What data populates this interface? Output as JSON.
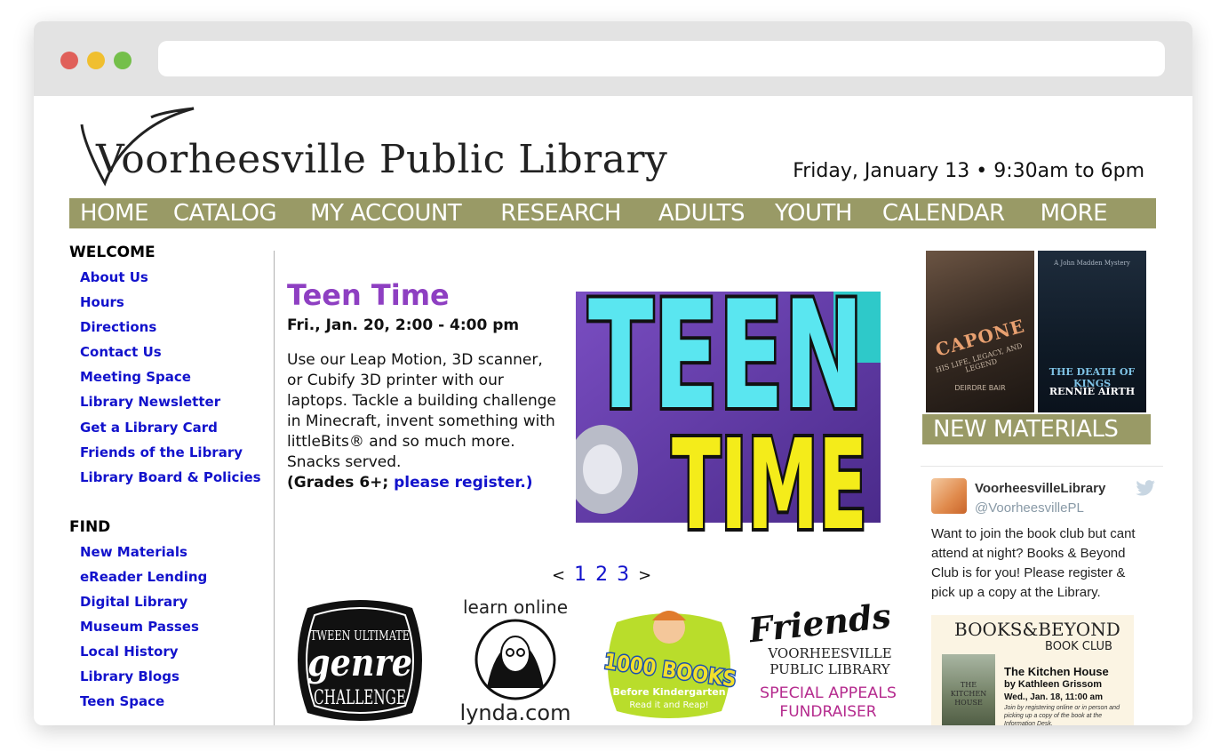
{
  "site": {
    "logo_text": "Voorheesville Public Library",
    "hours": "Friday, January 13 • 9:30am to 6pm"
  },
  "nav": {
    "items": [
      "HOME",
      "CATALOG",
      "MY ACCOUNT",
      "RESEARCH",
      "ADULTS",
      "YOUTH",
      "CALENDAR",
      "MORE"
    ]
  },
  "sidebar": {
    "welcome_heading": "WELCOME",
    "welcome_items": [
      "About Us",
      "Hours",
      "Directions",
      "Contact Us",
      "Meeting Space",
      "Library Newsletter",
      "Get a Library Card",
      "Friends of the Library",
      "Library Board & Policies"
    ],
    "find_heading": "FIND",
    "find_items": [
      "New Materials",
      "eReader Lending",
      "Digital Library",
      "Museum Passes",
      "Local History",
      "Library Blogs",
      "Teen Space"
    ]
  },
  "feature": {
    "title": "Teen Time",
    "date": "Fri., Jan. 20, 2:00 - 4:00 pm",
    "body": "Use our Leap Motion, 3D scanner, or Cubify 3D printer with our laptops. Tackle a building challenge in Minecraft, invent something with littleBits® and so much more. Snacks served.",
    "grades_prefix": "(Grades 6+; ",
    "register_link": "please register.)",
    "image_text_line1": "TEEN",
    "image_text_line2": "TIME"
  },
  "pager": {
    "prev": "<",
    "pages": [
      "1",
      "2",
      "3"
    ],
    "next": ">"
  },
  "badges": {
    "tween_line1": "TWEEN ULTIMATE",
    "tween_line2": "genre",
    "tween_line3": "CHALLENGE",
    "lynda_top": "learn online",
    "lynda_brand": "lynda.com",
    "thousand_main": "1000 BOOKS",
    "thousand_sub1": "Before Kindergarten",
    "thousand_sub2": "Read it and Reap!",
    "friends_script": "Friends",
    "friends_line1": "VOORHEESVILLE",
    "friends_line2": "PUBLIC LIBRARY",
    "friends_appeal1": "SPECIAL APPEALS",
    "friends_appeal2": "FUNDRAISER"
  },
  "new_materials": {
    "book1_title": "CAPONE",
    "book1_sub": "HIS LIFE, LEGACY, AND LEGEND",
    "book1_author": "DEIRDRE BAIR",
    "book2_series": "A John Madden Mystery",
    "book2_title": "THE DEATH OF KINGS",
    "book2_author": "RENNIE AIRTH",
    "label": "NEW MATERIALS"
  },
  "tweet": {
    "name": "VoorheesvilleLibrary",
    "handle": "@VoorheesvillePL",
    "text": "Want to join the book club but cant attend at night? Books & Beyond Club is for you!  Please register & pick up a copy at the Library.",
    "club_title": "BOOKS&BEYOND",
    "club_sub": "BOOK CLUB",
    "club_book_cover": "THE KITCHEN HOUSE",
    "club_book": "The Kitchen House",
    "club_author": "by Kathleen Grissom",
    "club_when": "Wed., Jan. 18, 11:00 am",
    "club_note": "Join by registering online or in person and picking up a copy of the book at the Information Desk."
  },
  "colors": {
    "nav_bg": "#999a66",
    "link": "#1212cc",
    "feature_title": "#8e3fc2"
  }
}
